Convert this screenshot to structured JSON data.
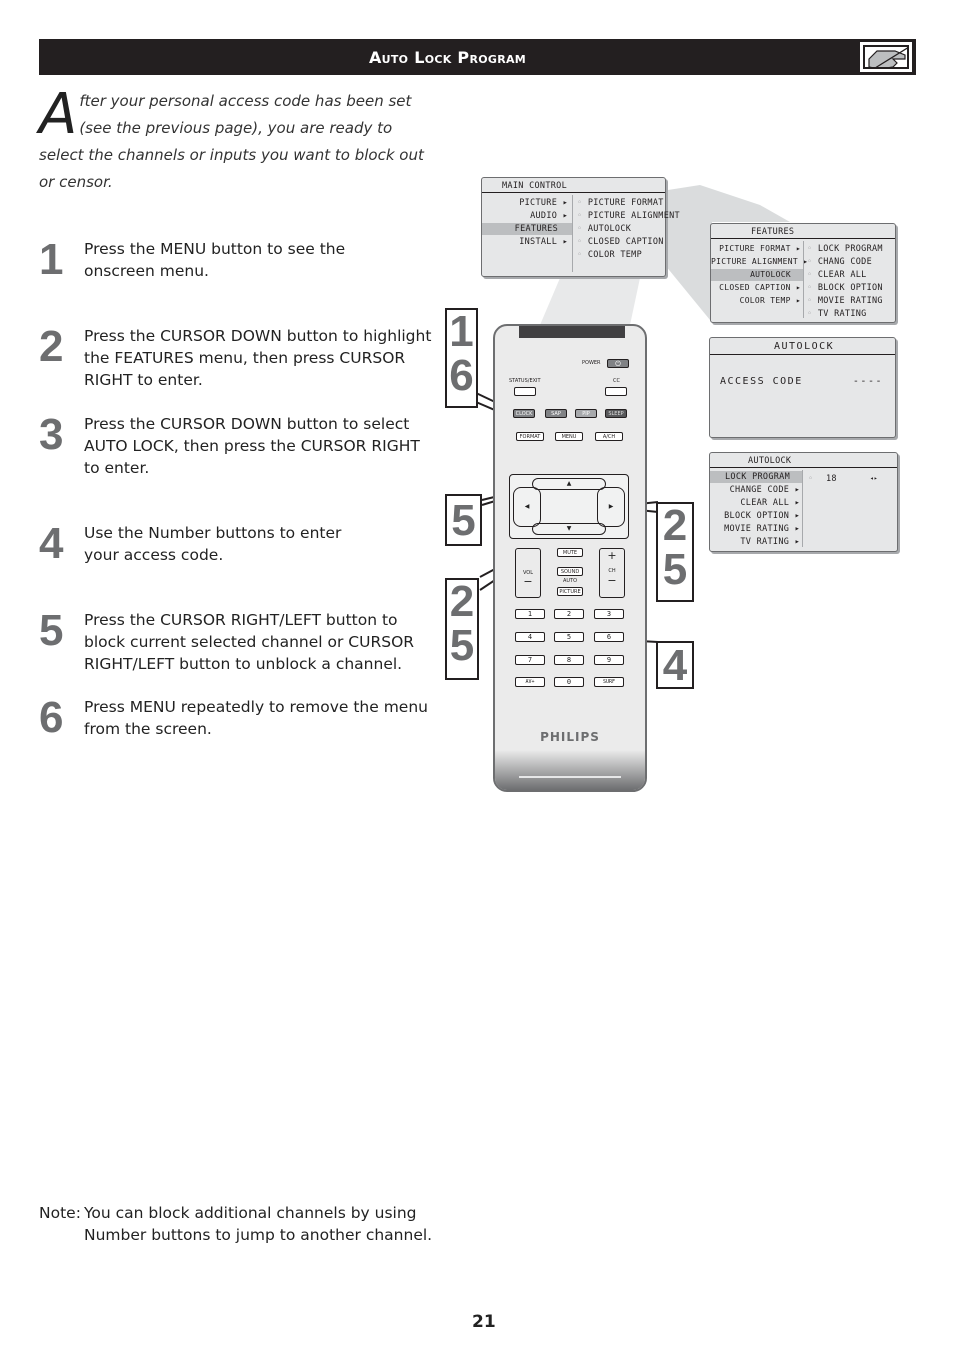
{
  "header": {
    "title": "Auto Lock Program",
    "icon": "pointing-hand-icon"
  },
  "intro": {
    "dropcap": "A",
    "text": "fter your personal access code has been set (see the previous page), you are ready to select the channels or inputs you want to block out or censor."
  },
  "steps": [
    {
      "num": "1",
      "text": "Press the MENU button to see the onscreen menu."
    },
    {
      "num": "2",
      "text": "Press the CURSOR DOWN button to highlight the FEATURES menu, then press CURSOR RIGHT to enter."
    },
    {
      "num": "3",
      "text": "Press the CURSOR DOWN button to select AUTO LOCK, then press the CURSOR RIGHT to enter."
    },
    {
      "num": "4",
      "text": "Use the Number buttons to enter your access code."
    },
    {
      "num": "5",
      "text": "Press the CURSOR RIGHT/LEFT button to block current selected channel or CURSOR RIGHT/LEFT button to unblock a channel."
    },
    {
      "num": "6",
      "text": "Press MENU repeatedly to remove the menu from the screen."
    }
  ],
  "note": {
    "label": "Note:",
    "line1": "You can block additional channels by using",
    "line2": "Number buttons to jump to another channel."
  },
  "page_number": "21",
  "osd_main": {
    "title": "MAIN CONTROL",
    "left": [
      {
        "label": "PICTURE",
        "arrow": "▸",
        "highlighted": false
      },
      {
        "label": "AUDIO",
        "arrow": "▸",
        "highlighted": false
      },
      {
        "label": "FEATURES",
        "arrow": "",
        "highlighted": true
      },
      {
        "label": "INSTALL",
        "arrow": "▸",
        "highlighted": false
      }
    ],
    "right": [
      "PICTURE FORMAT",
      "PICTURE ALIGNMENT",
      "AUTOLOCK",
      "CLOSED CAPTION",
      "COLOR TEMP"
    ]
  },
  "osd_features": {
    "title": "FEATURES",
    "left": [
      {
        "label": "PICTURE FORMAT",
        "arrow": "▸",
        "highlighted": false
      },
      {
        "label": "PICTURE ALIGNMENT",
        "arrow": "▸",
        "highlighted": false
      },
      {
        "label": "AUTOLOCK",
        "arrow": "",
        "highlighted": true
      },
      {
        "label": "CLOSED CAPTION",
        "arrow": "▸",
        "highlighted": false
      },
      {
        "label": "COLOR TEMP",
        "arrow": "▸",
        "highlighted": false
      }
    ],
    "right": [
      "LOCK PROGRAM",
      "CHANG CODE",
      "CLEAR ALL",
      "BLOCK OPTION",
      "MOVIE RATING",
      "TV RATING"
    ]
  },
  "osd_access": {
    "title": "AUTOLOCK",
    "label": "ACCESS CODE",
    "value": "----"
  },
  "osd_autolock": {
    "title": "AUTOLOCK",
    "left": [
      {
        "label": "LOCK PROGRAM",
        "arrow": "",
        "highlighted": true
      },
      {
        "label": "CHANGE CODE",
        "arrow": "▸",
        "highlighted": false
      },
      {
        "label": "CLEAR ALL",
        "arrow": "▸",
        "highlighted": false
      },
      {
        "label": "BLOCK OPTION",
        "arrow": "▸",
        "highlighted": false
      },
      {
        "label": "MOVIE RATING",
        "arrow": "▸",
        "highlighted": false
      },
      {
        "label": "TV RATING",
        "arrow": "▸",
        "highlighted": false
      }
    ],
    "channel": "18",
    "lock_symbol": "◂▸"
  },
  "remote": {
    "power_label": "POWER",
    "power_icon": "⏻",
    "status_exit_label": "STATUS/EXIT",
    "cc_label": "CC",
    "color_buttons": [
      "CLOCK",
      "SAP",
      "PIP",
      "SLEEP"
    ],
    "row_buttons": [
      "FORMAT",
      "MENU",
      "A/CH"
    ],
    "cursor_up": "▲",
    "cursor_down": "▼",
    "cursor_left": "◀",
    "cursor_right": "▶",
    "mute": "MUTE",
    "vol": "VOL",
    "ch": "CH",
    "plus": "+",
    "minus": "−",
    "sound": "SOUND",
    "auto": "AUTO",
    "picture": "PICTURE",
    "numbers": [
      "1",
      "2",
      "3",
      "4",
      "5",
      "6",
      "7",
      "8",
      "9"
    ],
    "av": "AV+",
    "zero": "0",
    "surf": "SURF",
    "brand": "PHILIPS"
  },
  "callouts": {
    "menu": [
      "1",
      "6"
    ],
    "left": [
      "5"
    ],
    "right": [
      "2",
      "5"
    ],
    "down": [
      "2",
      "5"
    ],
    "numbers": [
      "4"
    ]
  }
}
